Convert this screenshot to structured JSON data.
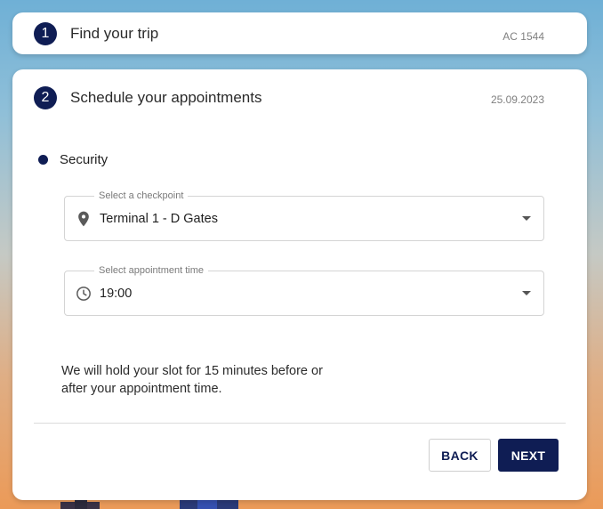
{
  "trip_step": {
    "number": "1",
    "title": "Find your trip",
    "flight": "AC 1544"
  },
  "schedule_step": {
    "number": "2",
    "title": "Schedule your appointments",
    "date": "25.09.2023",
    "section": {
      "title": "Security",
      "checkpoint": {
        "label": "Select a checkpoint",
        "value": "Terminal 1 - D Gates",
        "icon": "location-pin-icon"
      },
      "time": {
        "label": "Select appointment time",
        "value": "19:00",
        "icon": "clock-icon"
      },
      "info_line1": "We will hold your slot for 15 minutes before or",
      "info_line2": "after your appointment time."
    },
    "back_label": "BACK",
    "next_label": "NEXT"
  },
  "colors": {
    "primary": "#0f1d54",
    "sky_top": "#6fb0d6",
    "sky_bottom": "#eb9a58"
  }
}
